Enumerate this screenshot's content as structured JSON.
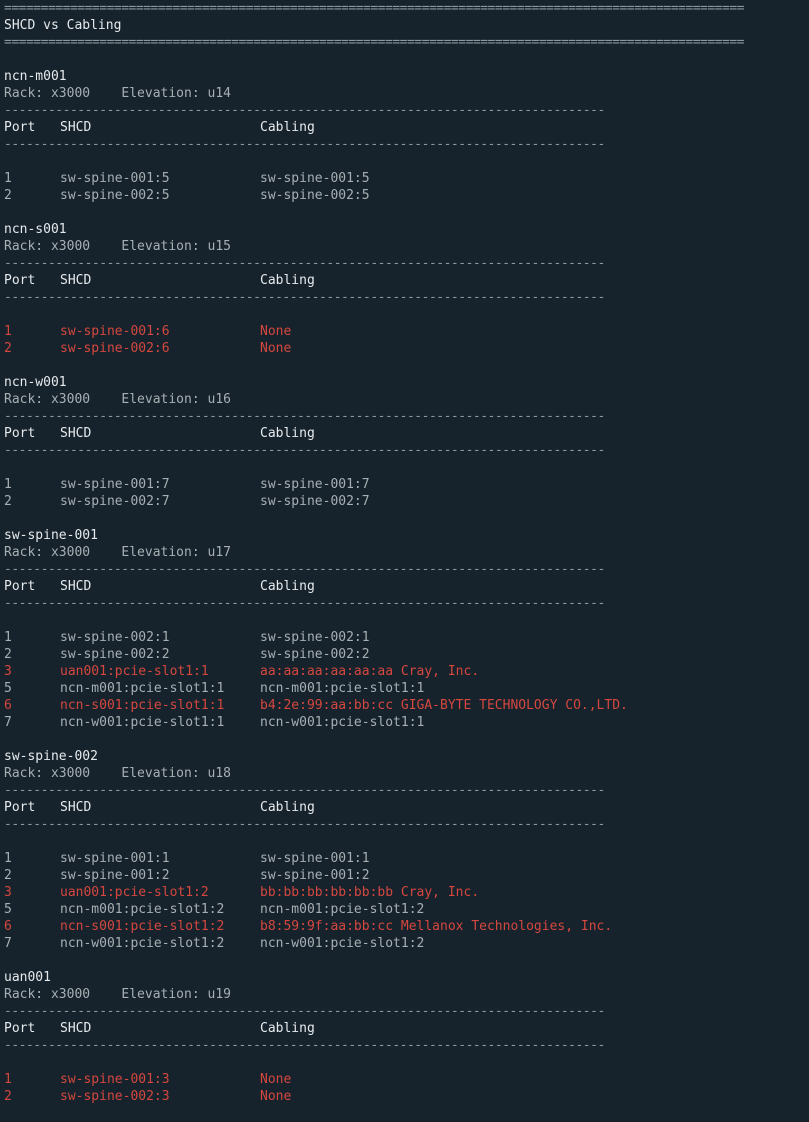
{
  "window": {
    "separator": "=====================================================================================================",
    "title": "SHCD vs Cabling"
  },
  "table": {
    "separator": "----------------------------------------------------------------------------------",
    "headers": {
      "port": "Port",
      "shcd": "SHCD",
      "cabling": "Cabling"
    }
  },
  "colors": {
    "mismatch": "#d5473f",
    "normal": "#a8afb4",
    "heading": "#e6eaed",
    "background": "#16232c"
  },
  "devices": [
    {
      "name": "ncn-m001",
      "meta": "Rack: x3000    Elevation: u14",
      "rows": [
        {
          "port": "1",
          "shcd": "sw-spine-001:5",
          "cabling": "sw-spine-001:5",
          "mismatch": false
        },
        {
          "port": "2",
          "shcd": "sw-spine-002:5",
          "cabling": "sw-spine-002:5",
          "mismatch": false
        }
      ]
    },
    {
      "name": "ncn-s001",
      "meta": "Rack: x3000    Elevation: u15",
      "rows": [
        {
          "port": "1",
          "shcd": "sw-spine-001:6",
          "cabling": "None",
          "mismatch": true
        },
        {
          "port": "2",
          "shcd": "sw-spine-002:6",
          "cabling": "None",
          "mismatch": true
        }
      ]
    },
    {
      "name": "ncn-w001",
      "meta": "Rack: x3000    Elevation: u16",
      "rows": [
        {
          "port": "1",
          "shcd": "sw-spine-001:7",
          "cabling": "sw-spine-001:7",
          "mismatch": false
        },
        {
          "port": "2",
          "shcd": "sw-spine-002:7",
          "cabling": "sw-spine-002:7",
          "mismatch": false
        }
      ]
    },
    {
      "name": "sw-spine-001",
      "meta": "Rack: x3000    Elevation: u17",
      "rows": [
        {
          "port": "1",
          "shcd": "sw-spine-002:1",
          "cabling": "sw-spine-002:1",
          "mismatch": false
        },
        {
          "port": "2",
          "shcd": "sw-spine-002:2",
          "cabling": "sw-spine-002:2",
          "mismatch": false
        },
        {
          "port": "3",
          "shcd": "uan001:pcie-slot1:1",
          "cabling": "aa:aa:aa:aa:aa:aa Cray, Inc.",
          "mismatch": true
        },
        {
          "port": "5",
          "shcd": "ncn-m001:pcie-slot1:1",
          "cabling": "ncn-m001:pcie-slot1:1",
          "mismatch": false
        },
        {
          "port": "6",
          "shcd": "ncn-s001:pcie-slot1:1",
          "cabling": "b4:2e:99:aa:bb:cc GIGA-BYTE TECHNOLOGY CO.,LTD.",
          "mismatch": true
        },
        {
          "port": "7",
          "shcd": "ncn-w001:pcie-slot1:1",
          "cabling": "ncn-w001:pcie-slot1:1",
          "mismatch": false
        }
      ]
    },
    {
      "name": "sw-spine-002",
      "meta": "Rack: x3000    Elevation: u18",
      "rows": [
        {
          "port": "1",
          "shcd": "sw-spine-001:1",
          "cabling": "sw-spine-001:1",
          "mismatch": false
        },
        {
          "port": "2",
          "shcd": "sw-spine-001:2",
          "cabling": "sw-spine-001:2",
          "mismatch": false
        },
        {
          "port": "3",
          "shcd": "uan001:pcie-slot1:2",
          "cabling": "bb:bb:bb:bb:bb:bb Cray, Inc.",
          "mismatch": true
        },
        {
          "port": "5",
          "shcd": "ncn-m001:pcie-slot1:2",
          "cabling": "ncn-m001:pcie-slot1:2",
          "mismatch": false
        },
        {
          "port": "6",
          "shcd": "ncn-s001:pcie-slot1:2",
          "cabling": "b8:59:9f:aa:bb:cc Mellanox Technologies, Inc.",
          "mismatch": true
        },
        {
          "port": "7",
          "shcd": "ncn-w001:pcie-slot1:2",
          "cabling": "ncn-w001:pcie-slot1:2",
          "mismatch": false
        }
      ]
    },
    {
      "name": "uan001",
      "meta": "Rack: x3000    Elevation: u19",
      "rows": [
        {
          "port": "1",
          "shcd": "sw-spine-001:3",
          "cabling": "None",
          "mismatch": true
        },
        {
          "port": "2",
          "shcd": "sw-spine-002:3",
          "cabling": "None",
          "mismatch": true
        }
      ]
    }
  ]
}
